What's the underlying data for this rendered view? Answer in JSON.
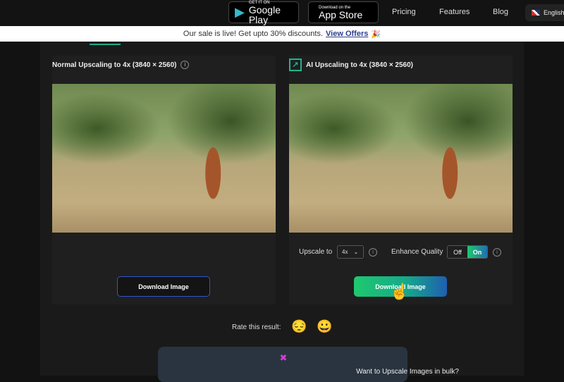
{
  "header": {
    "google_play": {
      "small": "GET IT ON",
      "big": "Google Play"
    },
    "app_store": {
      "small": "Download on the",
      "big": "App Store"
    },
    "nav": [
      "Pricing",
      "Features",
      "Blog"
    ],
    "language": "English"
  },
  "banner": {
    "text": "Our sale is live! Get upto 30% discounts.",
    "link": "View Offers",
    "emoji": "🎉"
  },
  "normal": {
    "title": "Normal Upscaling to 4x (3840 × 2560)",
    "download": "Download Image"
  },
  "ai": {
    "title": "AI Upscaling to 4x (3840 × 2560)",
    "upscale_label": "Upscale to",
    "upscale_value": "4x",
    "enhance_label": "Enhance Quality",
    "toggle_off": "Off",
    "toggle_on": "On",
    "enhance_on": true,
    "download": "Download Image",
    "accent_gradient": [
      "#1ec96e",
      "#1f5fb0"
    ]
  },
  "rating": {
    "label": "Rate this result:",
    "emojis": [
      "😔",
      "😀"
    ]
  },
  "bulk": {
    "text": "Want to Upscale Images in bulk?"
  }
}
